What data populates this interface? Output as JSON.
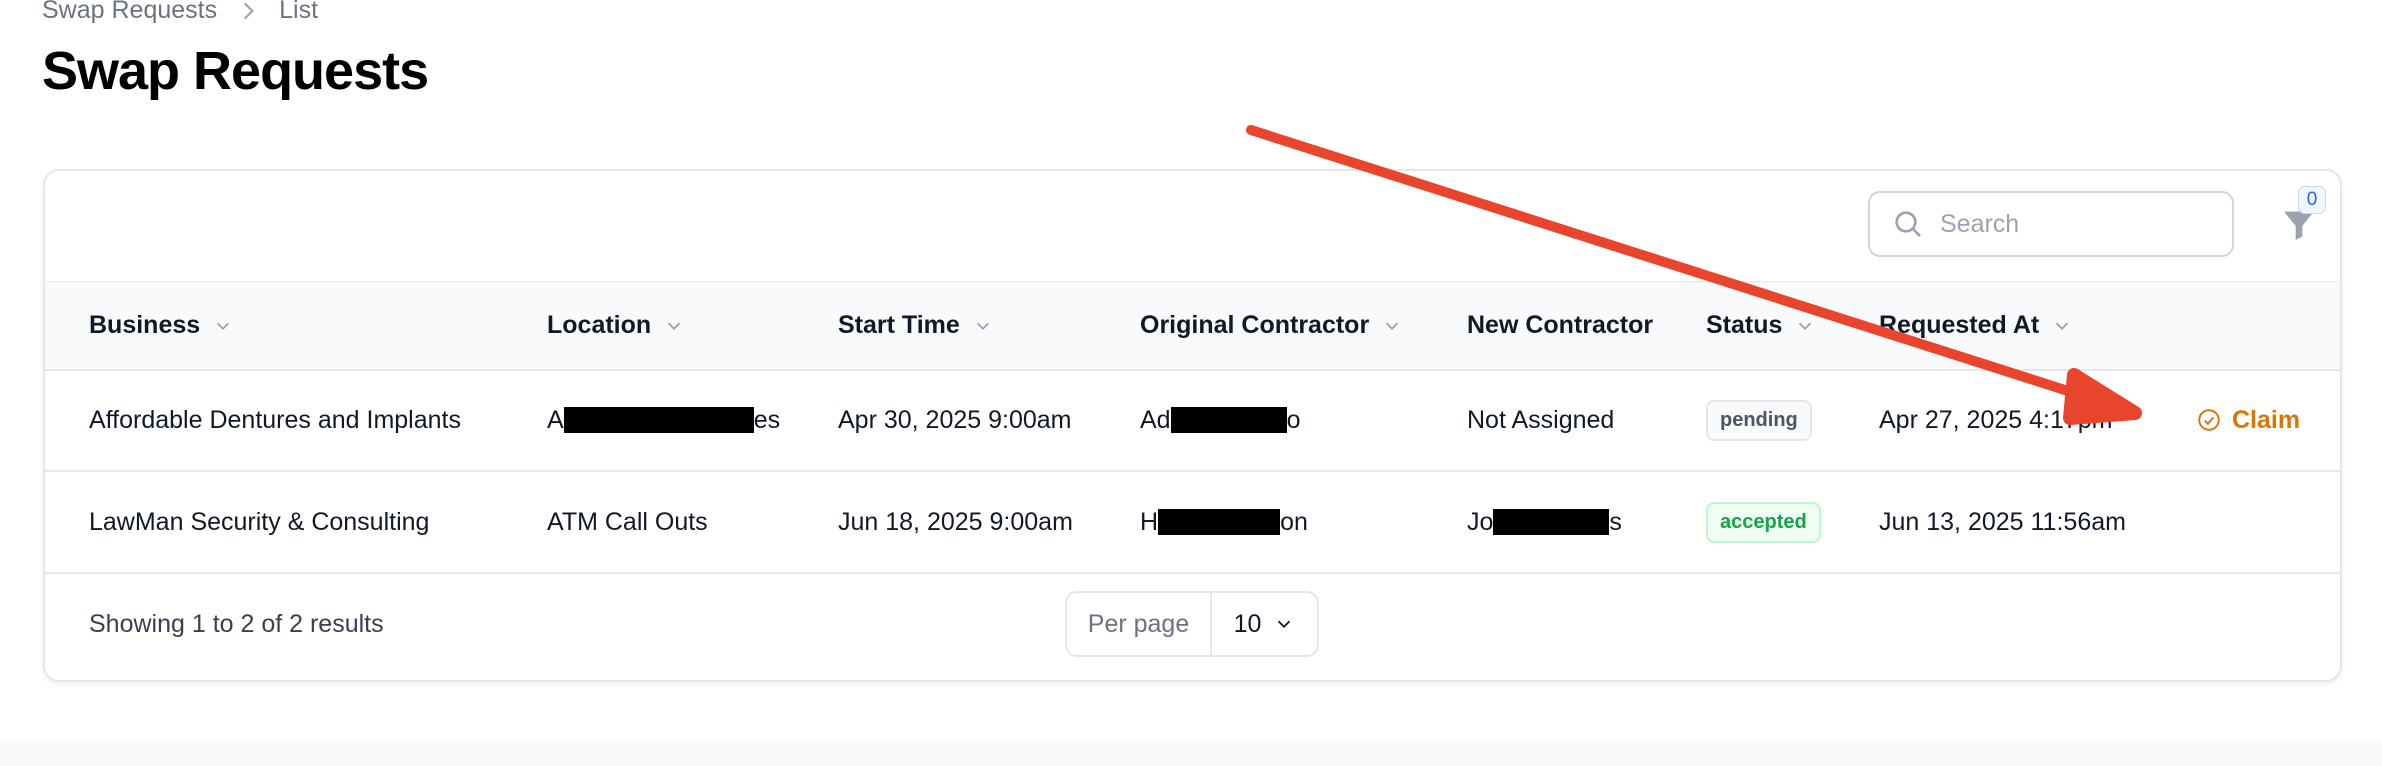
{
  "breadcrumb": {
    "items": [
      "Swap Requests",
      "List"
    ]
  },
  "page_title": "Swap Requests",
  "search": {
    "placeholder": "Search",
    "value": ""
  },
  "filter": {
    "count": "0"
  },
  "table": {
    "columns": [
      "Business",
      "Location",
      "Start Time",
      "Original Contractor",
      "New Contractor",
      "Status",
      "Requested At"
    ],
    "rows": [
      {
        "business": "Affordable Dentures and Implants",
        "location_prefix": "A",
        "location_suffix": "es",
        "start_time": "Apr 30, 2025 9:00am",
        "original_prefix": "Ad",
        "original_suffix": "o",
        "new_contractor": "Not Assigned",
        "status": "pending",
        "requested_at": "Apr 27, 2025 4:17pm",
        "action": "Claim"
      },
      {
        "business": "LawMan Security & Consulting",
        "location": "ATM Call Outs",
        "start_time": "Jun 18, 2025 9:00am",
        "original_prefix": "H",
        "original_suffix": "on",
        "new_prefix": "Jo",
        "new_suffix": "s",
        "status": "accepted",
        "requested_at": "Jun 13, 2025 11:56am"
      }
    ]
  },
  "footer": {
    "showing": "Showing 1 to 2 of 2 results",
    "per_page_label": "Per page",
    "per_page_value": "10"
  },
  "colors": {
    "accent": "#d97706",
    "annotation_arrow": "#e8452c"
  }
}
